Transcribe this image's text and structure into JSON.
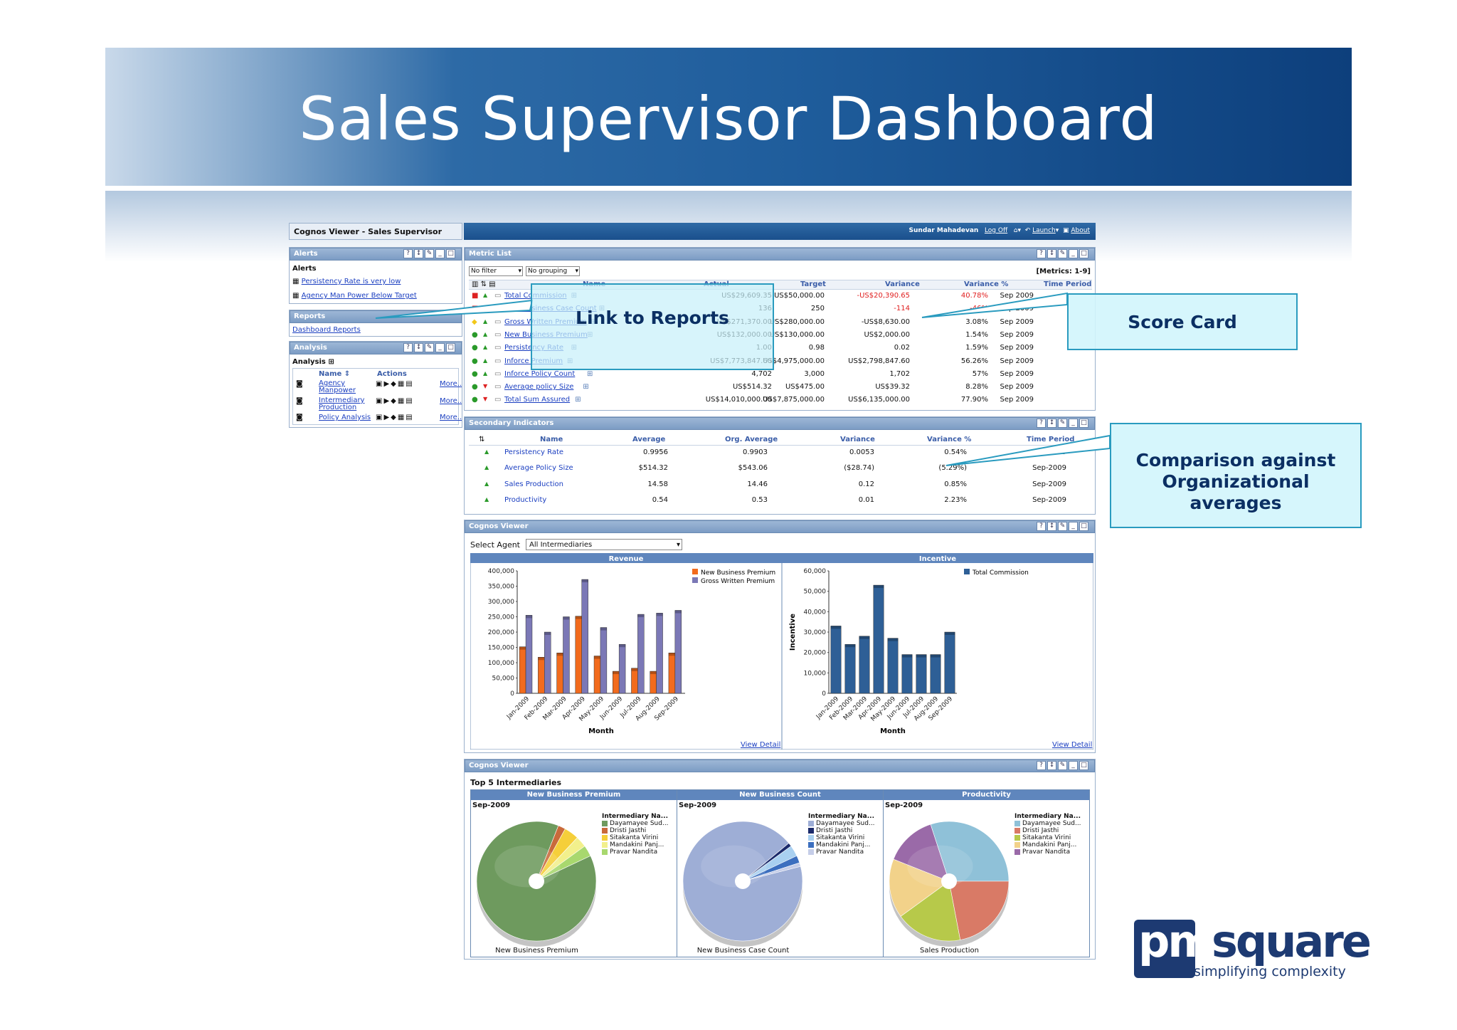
{
  "slide": {
    "title": "Sales Supervisor Dashboard",
    "logo_text": "pmsquare",
    "logo_tagline": "simplifying complexity"
  },
  "callouts": {
    "reports": "Link to Reports",
    "scorecard": "Score Card",
    "comparison": "Comparison against Organizational averages"
  },
  "app": {
    "window_title": "Cognos Viewer - Sales Supervisor",
    "user": "Sundar Mahadevan",
    "log_off": "Log Off",
    "launch": "Launch",
    "about": "About"
  },
  "alerts": {
    "header": "Alerts",
    "section": "Alerts",
    "items": [
      "Persistency Rate is very low",
      "Agency Man Power Below Target"
    ]
  },
  "reports": {
    "header": "Reports",
    "items": [
      "Dashboard Reports"
    ]
  },
  "analysis": {
    "header": "Analysis",
    "section": "Analysis",
    "col_name": "Name",
    "col_actions": "Actions",
    "more": "More...",
    "items": [
      "Agency Manpower",
      "Intermediary Production",
      "Policy Analysis"
    ]
  },
  "metric_list": {
    "header": "Metric List",
    "filter": "No filter",
    "grouping": "No grouping",
    "count": "[Metrics: 1-9]",
    "columns": [
      "Name",
      "Actual",
      "Target",
      "Variance",
      "Variance %",
      "Time Period"
    ],
    "rows": [
      {
        "status": "red",
        "trend": "up",
        "name": "Total Commission",
        "actual": "US$29,609.35",
        "target": "US$50,000.00",
        "variance": "-US$20,390.65",
        "variance_pct": "40.78%",
        "period": "Sep 2009",
        "neg": true
      },
      {
        "status": "red",
        "trend": "up",
        "name": "New Business Case Count",
        "actual": "136",
        "target": "250",
        "variance": "-114",
        "variance_pct": "-46%",
        "period": "Sep 2009",
        "neg": true
      },
      {
        "status": "yellow",
        "trend": "up",
        "name": "Gross Written Premium",
        "actual": "US$271,370.00",
        "target": "US$280,000.00",
        "variance": "-US$8,630.00",
        "variance_pct": "3.08%",
        "period": "Sep 2009",
        "neg": false
      },
      {
        "status": "green",
        "trend": "up",
        "name": "New Business Premium",
        "actual": "US$132,000.00",
        "target": "US$130,000.00",
        "variance": "US$2,000.00",
        "variance_pct": "1.54%",
        "period": "Sep 2009",
        "neg": false
      },
      {
        "status": "green",
        "trend": "up",
        "name": "Persistency Rate",
        "actual": "1.00",
        "target": "0.98",
        "variance": "0.02",
        "variance_pct": "1.59%",
        "period": "Sep 2009",
        "neg": false
      },
      {
        "status": "green",
        "trend": "up",
        "name": "Inforce Premium",
        "actual": "US$7,773,847.60",
        "target": "US$4,975,000.00",
        "variance": "US$2,798,847.60",
        "variance_pct": "56.26%",
        "period": "Sep 2009",
        "neg": false
      },
      {
        "status": "green",
        "trend": "up",
        "name": "Inforce Policy Count",
        "actual": "4,702",
        "target": "3,000",
        "variance": "1,702",
        "variance_pct": "57%",
        "period": "Sep 2009",
        "neg": false
      },
      {
        "status": "green",
        "trend": "down",
        "name": "Average policy Size",
        "actual": "US$514.32",
        "target": "US$475.00",
        "variance": "US$39.32",
        "variance_pct": "8.28%",
        "period": "Sep 2009",
        "neg": false
      },
      {
        "status": "green",
        "trend": "down",
        "name": "Total Sum Assured",
        "actual": "US$14,010,000.00",
        "target": "US$7,875,000.00",
        "variance": "US$6,135,000.00",
        "variance_pct": "77.90%",
        "period": "Sep 2009",
        "neg": false
      }
    ]
  },
  "secondary": {
    "header": "Secondary Indicators",
    "columns": [
      "Name",
      "Average",
      "Org. Average",
      "Variance",
      "Variance %",
      "Time Period"
    ],
    "rows": [
      {
        "name": "Persistency Rate",
        "average": "0.9956",
        "org_average": "0.9903",
        "variance": "0.0053",
        "variance_pct": "0.54%",
        "period": "Sep-2009"
      },
      {
        "name": "Average Policy Size",
        "average": "$514.32",
        "org_average": "$543.06",
        "variance": "($28.74)",
        "variance_pct": "(5.29%)",
        "period": "Sep-2009"
      },
      {
        "name": "Sales Production",
        "average": "14.58",
        "org_average": "14.46",
        "variance": "0.12",
        "variance_pct": "0.85%",
        "period": "Sep-2009"
      },
      {
        "name": "Productivity",
        "average": "0.54",
        "org_average": "0.53",
        "variance": "0.01",
        "variance_pct": "2.23%",
        "period": "Sep-2009"
      }
    ]
  },
  "viewer1": {
    "header": "Cognos Viewer",
    "select_label": "Select Agent",
    "select_value": "All Intermediaries",
    "view_detail": "View Detail"
  },
  "viewer2": {
    "header": "Cognos Viewer",
    "section_title": "Top 5 Intermediaries",
    "legend_title": "Intermediary Na...",
    "period": "Sep-2009"
  },
  "colors": {
    "orange": "#f26b1d",
    "purple": "#7b78b6",
    "blue": "#2e5f96",
    "header_blue": "#1f5d9c"
  },
  "chart_data": [
    {
      "type": "bar",
      "title": "Revenue",
      "xlabel": "Month",
      "ylabel": "",
      "ylim": [
        0,
        400000
      ],
      "yticks": [
        "400,000",
        "350,000",
        "300,000",
        "250,000",
        "200,000",
        "150,000",
        "100,000",
        "50,000",
        "0"
      ],
      "categories": [
        "Jan-2009",
        "Feb-2009",
        "Mar-2009",
        "Apr-2009",
        "May-2009",
        "Jun-2009",
        "Jul-2009",
        "Aug-2009",
        "Sep-2009"
      ],
      "series": [
        {
          "name": "New Business Premium",
          "color": "#f26b1d",
          "values": [
            152000,
            118000,
            132000,
            252000,
            122000,
            72000,
            82000,
            72000,
            132000
          ]
        },
        {
          "name": "Gross Written Premium",
          "color": "#7b78b6",
          "values": [
            255000,
            200000,
            250000,
            372000,
            215000,
            160000,
            258000,
            262000,
            271000
          ]
        }
      ]
    },
    {
      "type": "bar",
      "title": "Incentive",
      "xlabel": "Month",
      "ylabel": "Incentive",
      "ylim": [
        0,
        60000
      ],
      "yticks": [
        "60,000",
        "50,000",
        "40,000",
        "30,000",
        "20,000",
        "10,000",
        "0"
      ],
      "categories": [
        "Jan-2009",
        "Feb-2009",
        "Mar-2009",
        "Apr-2009",
        "May-2009",
        "Jun-2009",
        "Jul-2009",
        "Aug-2009",
        "Sep-2009"
      ],
      "series": [
        {
          "name": "Total Commission",
          "color": "#2e5f96",
          "values": [
            33000,
            24000,
            28000,
            53000,
            27000,
            19000,
            19000,
            19000,
            30000
          ]
        }
      ]
    },
    {
      "type": "pie",
      "title": "New Business Premium",
      "caption": "New Business Premium",
      "categories": [
        "Dayamayee Sud...",
        "Dristi Jasthi",
        "Sitakanta Virini",
        "Mandakini Panj...",
        "Pravar Nandita"
      ],
      "colors": [
        "#6e9a5e",
        "#c96a3b",
        "#f5cf3a",
        "#f2f08c",
        "#a8d86e"
      ],
      "values": [
        88,
        2,
        4,
        3,
        3
      ]
    },
    {
      "type": "pie",
      "title": "New Business Count",
      "caption": "New Business Case Count",
      "categories": [
        "Dayamayee Sud...",
        "Dristi Jasthi",
        "Sitakanta Virini",
        "Mandakini Panj...",
        "Pravar Nandita"
      ],
      "colors": [
        "#9eaed6",
        "#1b2a6b",
        "#a9d0f0",
        "#3c6fbf",
        "#c5cde8"
      ],
      "values": [
        93,
        1,
        3,
        2,
        1
      ]
    },
    {
      "type": "pie",
      "title": "Productivity",
      "caption": "Sales Production",
      "categories": [
        "Dayamayee Sud...",
        "Dristi Jasthi",
        "Sitakanta Virini",
        "Mandakini Panj...",
        "Pravar Nandita"
      ],
      "colors": [
        "#8fc1d8",
        "#d97a66",
        "#b7c94a",
        "#f2d28a",
        "#9a6aa8"
      ],
      "values": [
        30,
        22,
        18,
        16,
        14
      ]
    }
  ]
}
